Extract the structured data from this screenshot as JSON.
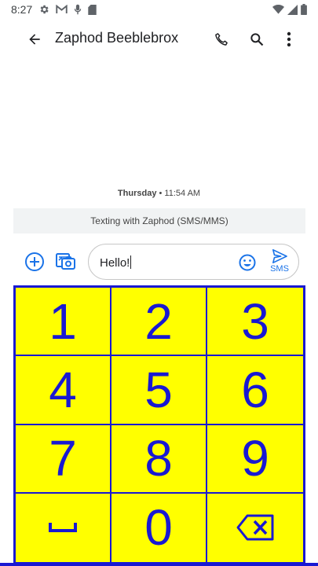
{
  "status_bar": {
    "time": "8:27",
    "left_icons": [
      "gear-icon",
      "gmail-icon",
      "mic-icon",
      "sd-card-icon"
    ],
    "right_icons": [
      "wifi-icon",
      "signal-icon",
      "battery-icon"
    ]
  },
  "header": {
    "contact_name": "Zaphod Beeblebrox",
    "actions": [
      "phone-icon",
      "search-icon",
      "more-vert-icon"
    ]
  },
  "conversation": {
    "date_day": "Thursday",
    "date_sep": " • ",
    "date_time": "11:54 AM",
    "banner": "Texting with Zaphod (SMS/MMS)"
  },
  "compose": {
    "text": "Hello!",
    "send_label": "SMS"
  },
  "keypad": {
    "keys": [
      "1",
      "2",
      "3",
      "4",
      "5",
      "6",
      "7",
      "8",
      "9",
      "␣",
      "0",
      "⌫"
    ]
  },
  "colors": {
    "accent": "#1a73e8",
    "keypad_bg": "#ffff00",
    "keypad_fg": "#1919d2"
  }
}
